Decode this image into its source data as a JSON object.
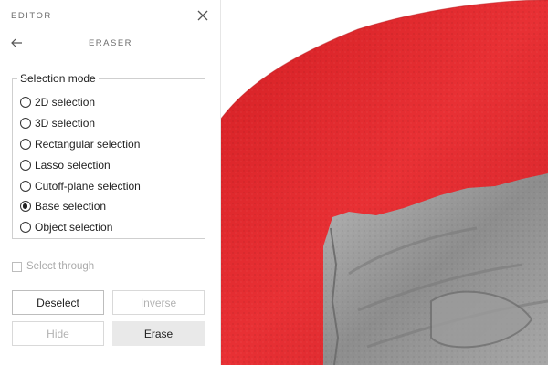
{
  "panel": {
    "header": "EDITOR",
    "tool_title": "ERASER",
    "selection_mode": {
      "legend": "Selection mode",
      "options": [
        {
          "label": "2D selection",
          "checked": false
        },
        {
          "label": "3D selection",
          "checked": false
        },
        {
          "label": "Rectangular selection",
          "checked": false
        },
        {
          "label": "Lasso selection",
          "checked": false
        },
        {
          "label": "Cutoff-plane selection",
          "checked": false
        },
        {
          "label": "Base selection",
          "checked": true
        },
        {
          "label": "Object selection",
          "checked": false
        }
      ]
    },
    "select_through": {
      "label": "Select through",
      "checked": false,
      "enabled": false
    },
    "buttons": {
      "deselect": "Deselect",
      "inverse": "Inverse",
      "hide": "Hide",
      "erase": "Erase"
    }
  },
  "icons": {
    "close": "close-icon",
    "back": "arrow-left-icon"
  },
  "colors": {
    "selection_red": "#e52a2e",
    "scan_gray": "#9a9a9a"
  }
}
